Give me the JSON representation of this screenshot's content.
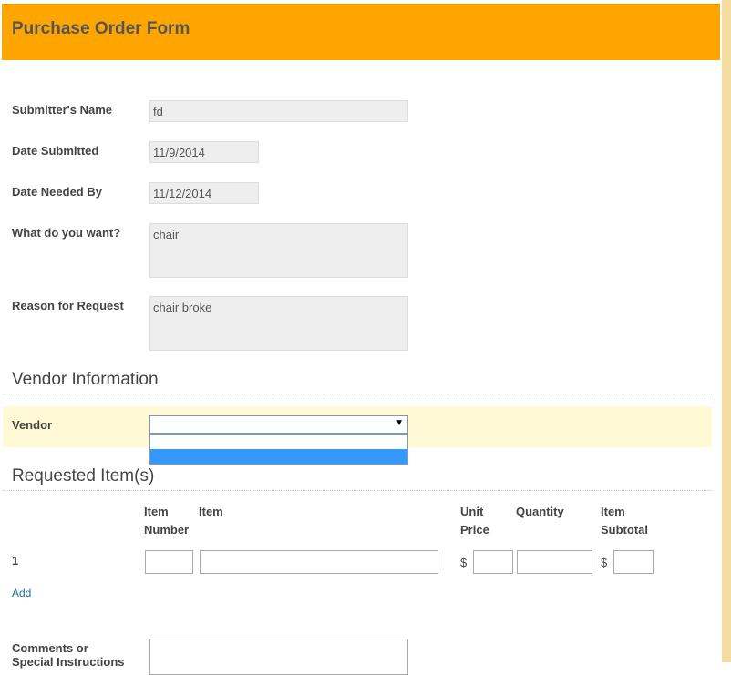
{
  "header": {
    "title": "Purchase Order Form"
  },
  "fields": {
    "submitter_name": {
      "label": "Submitter's Name",
      "value": "fd"
    },
    "date_submitted": {
      "label": "Date Submitted",
      "value": "11/9/2014"
    },
    "date_needed": {
      "label": "Date Needed By",
      "value": "11/12/2014"
    },
    "what_want": {
      "label": "What do you want?",
      "value": "chair"
    },
    "reason": {
      "label": "Reason for Request",
      "value": "chair broke"
    }
  },
  "vendor_section": {
    "title": "Vendor Information",
    "vendor_label": "Vendor",
    "vendor_value": "",
    "dropdown_arrow": "▼"
  },
  "items_section": {
    "title": "Requested Item(s)",
    "columns": {
      "item_number": "Item\nNumber",
      "item": "Item",
      "unit_price": "Unit\nPrice",
      "quantity": "Quantity",
      "item_subtotal": "Item\nSubtotal"
    },
    "row_number": "1",
    "currency_symbol": "$",
    "add_link": "Add"
  },
  "comments": {
    "label": "Comments or\nSpecial Instructions"
  },
  "colors": {
    "header": "#ffa500",
    "vendor_highlight": "#fff9d6",
    "selection": "#3399ff"
  }
}
